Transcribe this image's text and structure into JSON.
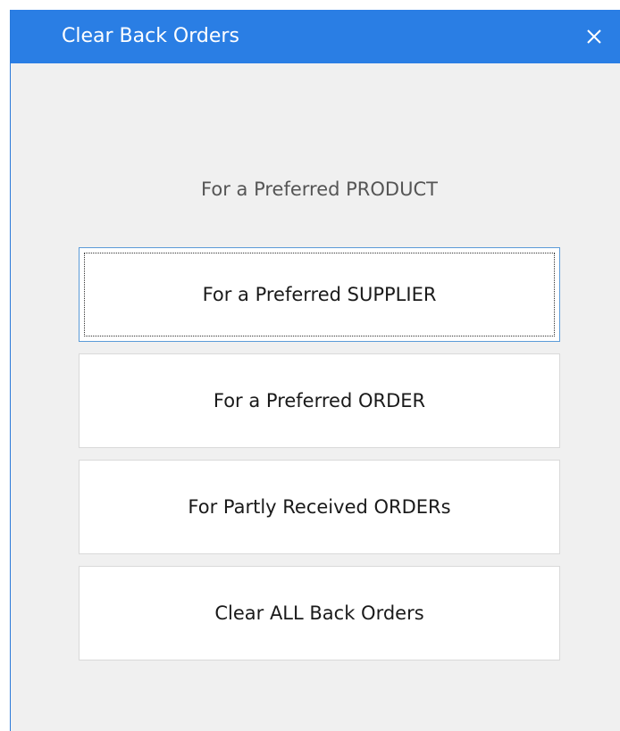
{
  "window": {
    "title": "Clear Back Orders",
    "close_icon": "close-icon"
  },
  "options": {
    "product_label": "For a Preferred PRODUCT",
    "supplier_button": "For a Preferred SUPPLIER",
    "order_button": "For a Preferred ORDER",
    "partly_received_button": "For Partly Received ORDERs",
    "clear_all_button": "Clear ALL Back Orders"
  },
  "colors": {
    "title_bar": "#2a7ee4",
    "window_background": "#f0f0f0",
    "button_background": "#ffffff",
    "focus_border": "#5b9bd8"
  }
}
